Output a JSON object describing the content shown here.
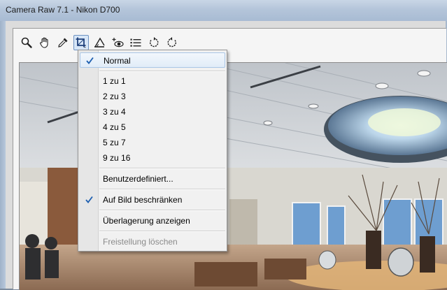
{
  "window": {
    "title": "Camera Raw 7.1 - Nikon D700"
  },
  "toolbar": {
    "tools": [
      {
        "name": "zoom-icon"
      },
      {
        "name": "hand-icon"
      },
      {
        "name": "eyedropper-icon"
      },
      {
        "name": "crop-icon",
        "active": true
      },
      {
        "name": "straighten-icon"
      },
      {
        "name": "redeye-icon"
      },
      {
        "name": "list-icon"
      },
      {
        "name": "rotate-ccw-icon"
      },
      {
        "name": "rotate-cw-icon"
      }
    ]
  },
  "crop_menu": {
    "items": [
      {
        "label": "Normal",
        "checked": true,
        "highlighted": true
      },
      {
        "label": "1 zu 1"
      },
      {
        "label": "2 zu 3"
      },
      {
        "label": "3 zu 4"
      },
      {
        "label": "4 zu 5"
      },
      {
        "label": "5 zu 7"
      },
      {
        "label": "9 zu 16"
      },
      {
        "label": "Benutzerdefiniert..."
      },
      {
        "label": "Auf Bild beschränken",
        "checked": true
      },
      {
        "label": "Überlagerung anzeigen"
      },
      {
        "label": "Freistellung löschen",
        "disabled": true
      }
    ]
  },
  "colors": {
    "accent": "#1e5fb0",
    "highlight_border": "#aac6e6"
  }
}
